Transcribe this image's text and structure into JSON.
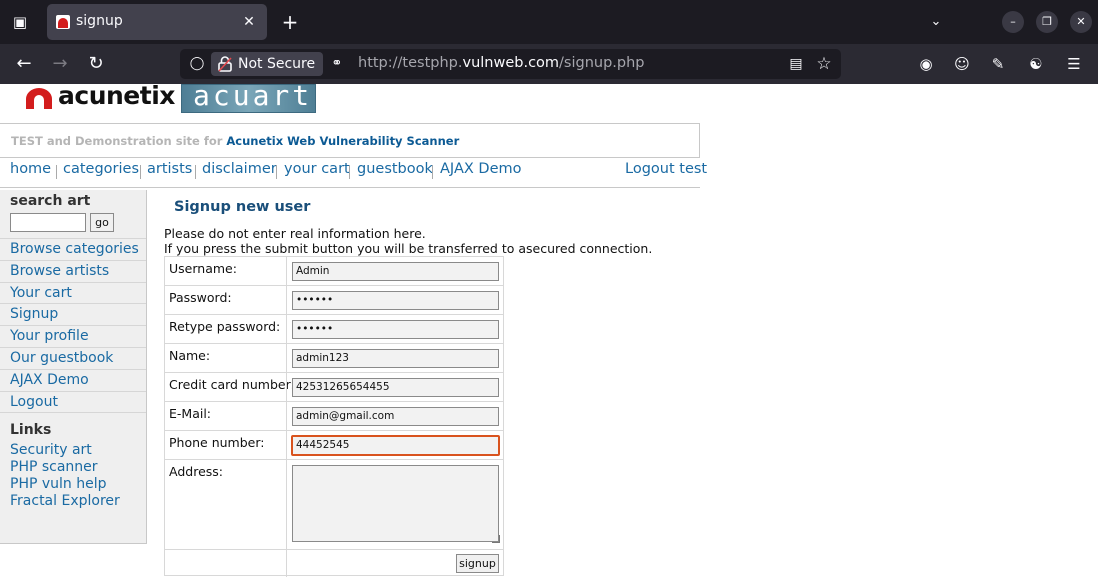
{
  "browser": {
    "tab_title": "signup",
    "url_scheme": "http://testphp.",
    "url_host": "vulnweb.com",
    "url_path": "/signup.php",
    "security_label": "Not Secure"
  },
  "site": {
    "logo_text": "acunetix",
    "banner_text": "acuart",
    "tagline_prefix": "TEST and Demonstration site for ",
    "tagline_link": "Acunetix Web Vulnerability Scanner"
  },
  "topnav": {
    "items": [
      "home",
      "categories",
      "artists",
      "disclaimer",
      "your cart",
      "guestbook",
      "AJAX Demo"
    ],
    "logout": "Logout test"
  },
  "sidebar": {
    "search_title": "search art",
    "search_value": "",
    "go_label": "go",
    "menu": [
      "Browse categories",
      "Browse artists",
      "Your cart",
      "Signup",
      "Your profile",
      "Our guestbook",
      "AJAX Demo",
      "Logout"
    ],
    "links_title": "Links",
    "links": [
      "Security art",
      "PHP scanner",
      "PHP vuln help",
      "Fractal Explorer"
    ]
  },
  "main": {
    "title": "Signup new user",
    "info1": "Please do not enter real information here.",
    "info2": "If you press the submit button you will be transferred to asecured connection.",
    "fields": [
      {
        "label": "Username:",
        "value": "Admin"
      },
      {
        "label": "Password:",
        "value": "••••••"
      },
      {
        "label": "Retype password:",
        "value": "••••••"
      },
      {
        "label": "Name:",
        "value": "admin123"
      },
      {
        "label": "Credit card number:",
        "value": "42531265654455"
      },
      {
        "label": "E-Mail:",
        "value": "admin@gmail.com"
      },
      {
        "label": "Phone number:",
        "value": "44452545"
      }
    ],
    "address_label": "Address:",
    "address_value": "",
    "submit_label": "signup"
  }
}
